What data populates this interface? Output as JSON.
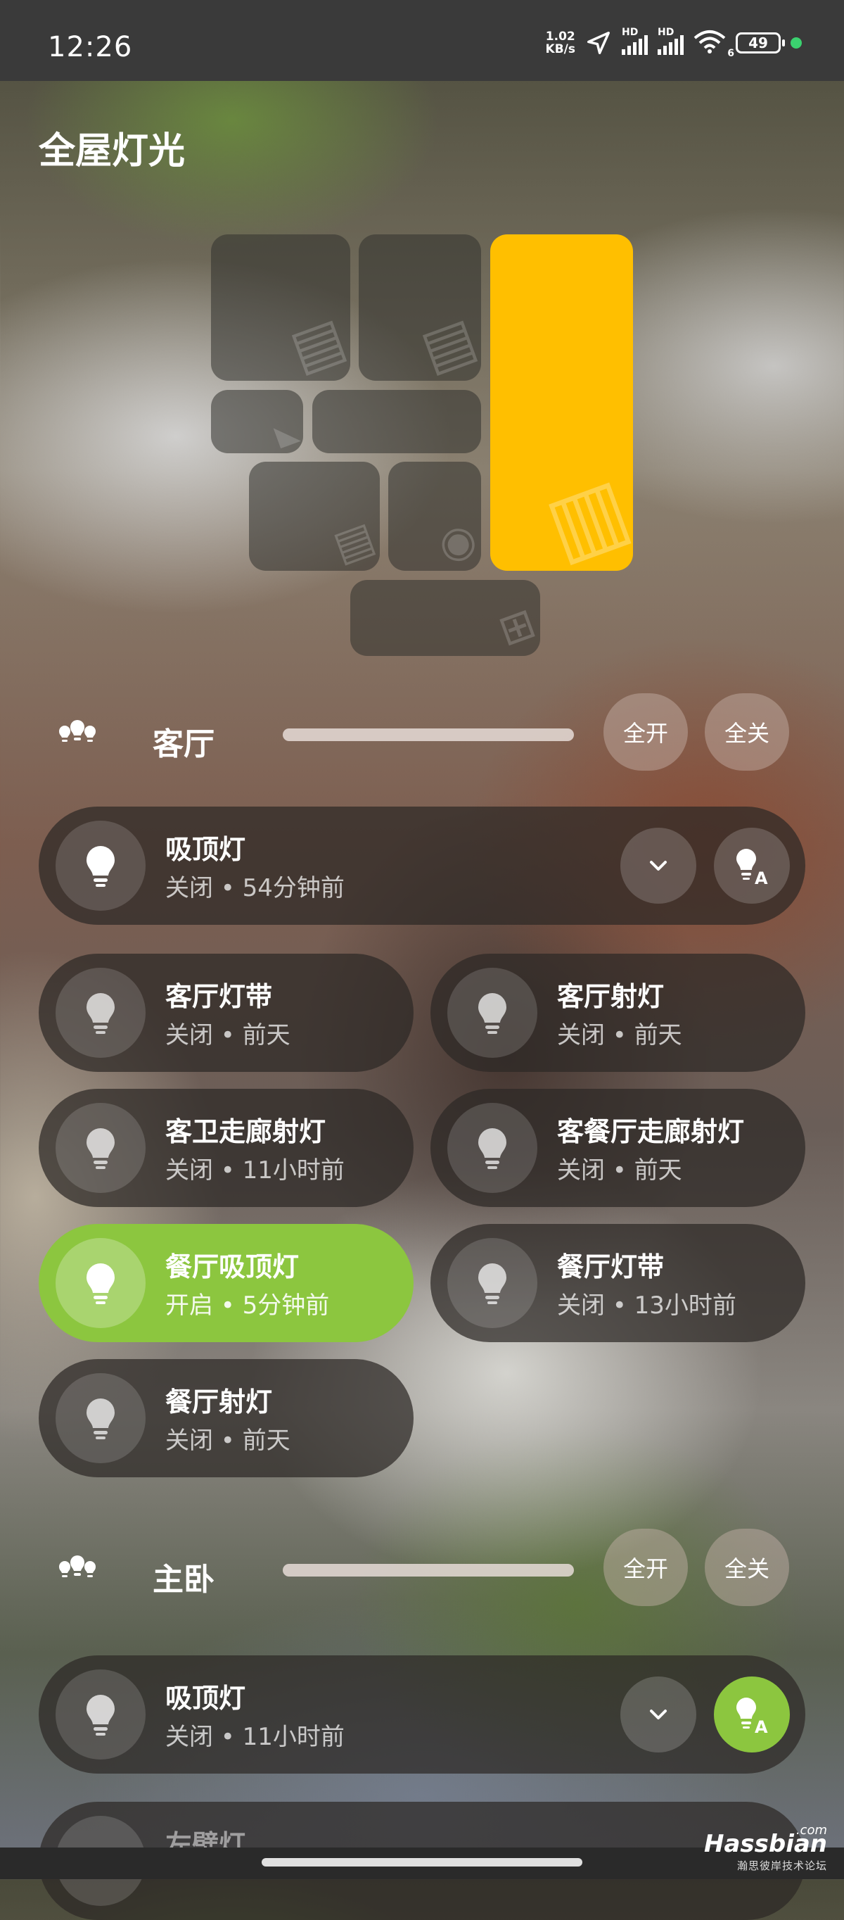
{
  "status_bar": {
    "time": "12:26",
    "speed_value": "1.02",
    "speed_unit": "KB/s",
    "hd_label": "HD",
    "wifi_band": "6",
    "battery": "49"
  },
  "page_title": "全屋灯光",
  "colors": {
    "accent_yellow": "#ffbf00",
    "accent_green": "#8cc63f",
    "statusbar_bg": "#3a3a3a"
  },
  "sections": [
    {
      "title": "客厅",
      "all_on": "全开",
      "all_off": "全关",
      "lights": [
        {
          "name": "吸顶灯",
          "status": "关闭 • 54分钟前",
          "on": false
        },
        {
          "name": "客厅灯带",
          "status": "关闭 • 前天",
          "on": false
        },
        {
          "name": "客厅射灯",
          "status": "关闭 • 前天",
          "on": false
        },
        {
          "name": "客卫走廊射灯",
          "status": "关闭 • 11小时前",
          "on": false
        },
        {
          "name": "客餐厅走廊射灯",
          "status": "关闭 • 前天",
          "on": false
        },
        {
          "name": "餐厅吸顶灯",
          "status": "开启 • 5分钟前",
          "on": true
        },
        {
          "name": "餐厅灯带",
          "status": "关闭 • 13小时前",
          "on": false
        },
        {
          "name": "餐厅射灯",
          "status": "关闭 • 前天",
          "on": false
        }
      ]
    },
    {
      "title": "主卧",
      "all_on": "全开",
      "all_off": "全关",
      "lights": [
        {
          "name": "吸顶灯",
          "status": "关闭 • 11小时前",
          "on": false
        },
        {
          "name": "左壁灯",
          "status": "",
          "on": false
        }
      ]
    }
  ],
  "icons": {
    "expand": "chevron-down-icon",
    "auto_light": "bulb-auto-icon",
    "bulb": "bulb-icon",
    "room_lights": "lamp-group-icon"
  },
  "watermark": {
    "brand": "Hassbian",
    "com": ".com",
    "sub": "瀚思彼岸技术论坛"
  }
}
